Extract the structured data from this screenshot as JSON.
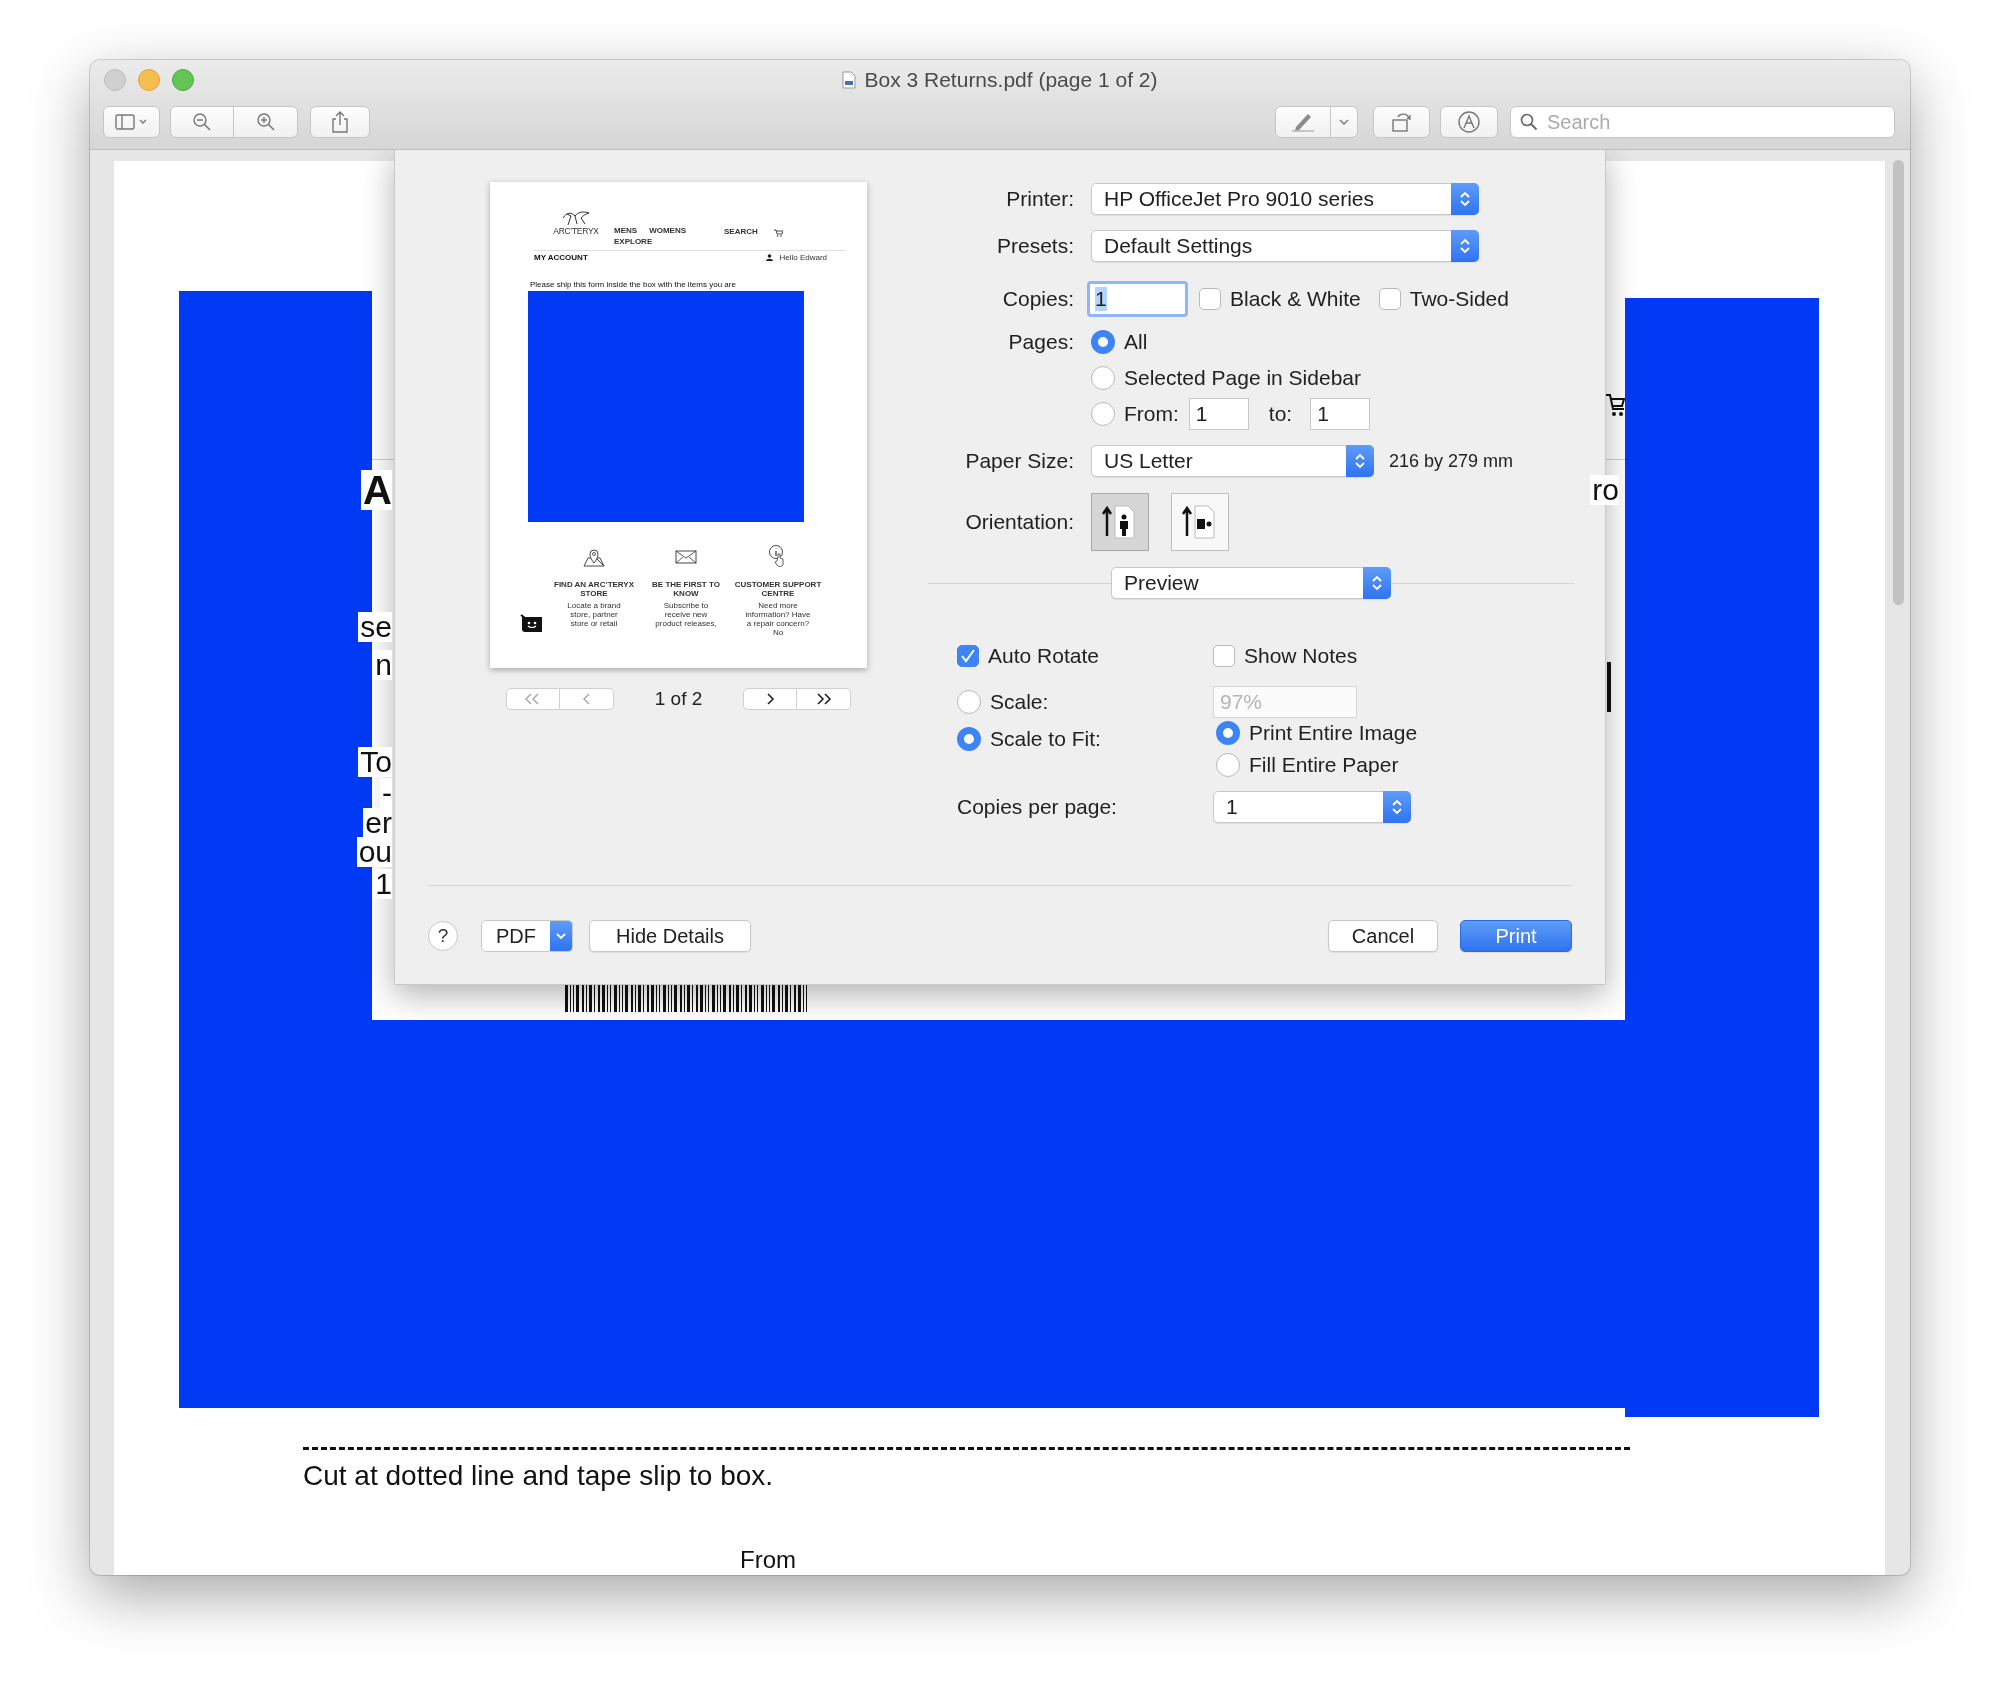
{
  "window": {
    "title": "Box 3 Returns.pdf (page 1 of 2)"
  },
  "toolbar": {
    "search": {
      "placeholder": "Search"
    }
  },
  "document": {
    "left_fragments": [
      "A",
      "se",
      "n",
      "To",
      "-",
      "er",
      "ou",
      "1"
    ],
    "right_fragments": [
      "ro"
    ],
    "cut_instruction": "Cut at dotted line and tape slip to box.",
    "from_label": "From"
  },
  "print_sheet": {
    "preview": {
      "page": {
        "brand": "ARC’TERYX",
        "nav": [
          "MENS",
          "WOMENS",
          "EXPLORE"
        ],
        "search": "SEARCH",
        "heading": "MY ACCOUNT",
        "greeting": "Hello Edward",
        "note": "Please ship this form inside the box with the items you are",
        "features": [
          {
            "kind": "store",
            "title": "FIND AN ARC’TERYX STORE",
            "text": "Locate a brand store, partner store or retail"
          },
          {
            "kind": "mail",
            "title": "BE THE FIRST TO KNOW",
            "text": "Subscribe to receive new product releases,"
          },
          {
            "kind": "support",
            "title": "CUSTOMER SUPPORT CENTRE",
            "text": "Need more information? Have a repair concern? No"
          }
        ]
      },
      "page_indicator": "1 of 2"
    },
    "printer": {
      "label": "Printer:",
      "value": "HP OfficeJet Pro 9010 series"
    },
    "presets": {
      "label": "Presets:",
      "value": "Default Settings"
    },
    "copies": {
      "label": "Copies:",
      "value": "1"
    },
    "copy_options": [
      {
        "label": "Black & White",
        "checked": false
      },
      {
        "label": "Two-Sided",
        "checked": false
      }
    ],
    "pages": {
      "label": "Pages:",
      "choices": [
        {
          "kind": "option",
          "label": "All",
          "selected": true
        },
        {
          "kind": "option",
          "label": "Selected Page in Sidebar",
          "selected": false
        },
        {
          "kind": "range",
          "label": "From:",
          "selected": false,
          "from": "1",
          "to_label": "to:",
          "to": "1"
        }
      ]
    },
    "paper_size": {
      "label": "Paper Size:",
      "value": "US Letter",
      "dimensions": "216 by 279 mm"
    },
    "orientation": {
      "label": "Orientation:",
      "choices": [
        {
          "kind": "portrait",
          "selected": true
        },
        {
          "kind": "landscape",
          "selected": false
        }
      ]
    },
    "section": "Preview",
    "preview_options": {
      "checkboxes": [
        {
          "label": "Auto Rotate",
          "checked": true
        },
        {
          "label": "Show Notes",
          "checked": false
        }
      ],
      "scale": {
        "label": "Scale:",
        "selected": false,
        "value": "97%",
        "disabled": true
      },
      "scale_to_fit": {
        "label": "Scale to Fit:",
        "selected": true,
        "choices": [
          {
            "label": "Print Entire Image",
            "selected": true
          },
          {
            "label": "Fill Entire Paper",
            "selected": false
          }
        ]
      },
      "copies_per_page": {
        "label": "Copies per page:",
        "value": "1"
      }
    },
    "buttons": {
      "help": "?",
      "pdf": "PDF",
      "details": "Hide Details",
      "cancel": "Cancel",
      "print": "Print"
    }
  }
}
